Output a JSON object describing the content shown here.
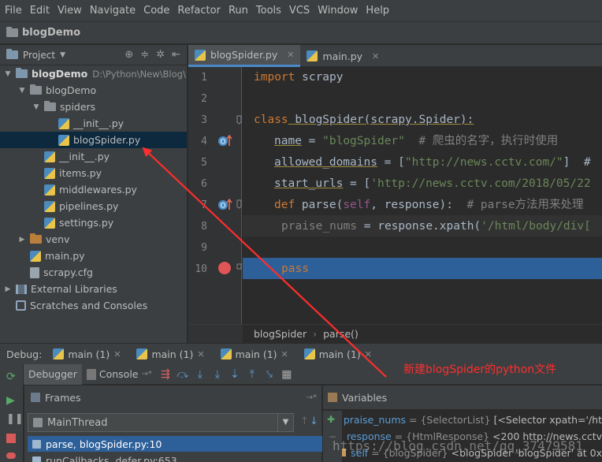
{
  "menu": [
    "File",
    "Edit",
    "View",
    "Navigate",
    "Code",
    "Refactor",
    "Run",
    "Tools",
    "VCS",
    "Window",
    "Help"
  ],
  "navbar": {
    "project": "blogDemo"
  },
  "project_panel": {
    "title": "Project",
    "tree": [
      {
        "label": "blogDemo",
        "path": "D:\\Python\\New\\Blog\\b",
        "icon": "folder-icon",
        "depth": 0,
        "expanded": true,
        "bold": true
      },
      {
        "label": "blogDemo",
        "icon": "folder-icon",
        "depth": 1,
        "expanded": true
      },
      {
        "label": "spiders",
        "icon": "folder-icon",
        "depth": 2,
        "expanded": true
      },
      {
        "label": "__init__.py",
        "icon": "python-file-icon",
        "depth": 3
      },
      {
        "label": "blogSpider.py",
        "icon": "python-file-icon",
        "depth": 3,
        "selected": true
      },
      {
        "label": "__init__.py",
        "icon": "python-file-icon",
        "depth": 2
      },
      {
        "label": "items.py",
        "icon": "python-file-icon",
        "depth": 2
      },
      {
        "label": "middlewares.py",
        "icon": "python-file-icon",
        "depth": 2
      },
      {
        "label": "pipelines.py",
        "icon": "python-file-icon",
        "depth": 2
      },
      {
        "label": "settings.py",
        "icon": "python-file-icon",
        "depth": 2
      },
      {
        "label": "venv",
        "icon": "folder-icon",
        "depth": 1,
        "expanded": false,
        "orange": true
      },
      {
        "label": "main.py",
        "icon": "python-file-icon",
        "depth": 1
      },
      {
        "label": "scrapy.cfg",
        "icon": "config-file-icon",
        "depth": 1
      },
      {
        "label": "External Libraries",
        "icon": "library-icon",
        "depth": 0,
        "expanded": false
      },
      {
        "label": "Scratches and Consoles",
        "icon": "scratches-icon",
        "depth": 0,
        "leaf": true
      }
    ]
  },
  "editor": {
    "tabs": [
      {
        "label": "blogSpider.py",
        "active": true
      },
      {
        "label": "main.py",
        "active": false
      }
    ],
    "line_numbers": [
      "1",
      "2",
      "3",
      "4",
      "5",
      "6",
      "7",
      "8",
      "9",
      "10"
    ],
    "code": {
      "l1_kw": "import",
      "l1_rest": " scrapy",
      "l3_kw": "class",
      "l3_rest": " blogSpider(scrapy.Spider):",
      "l4_name": "name",
      "l4_eq": " = ",
      "l4_str": "\"blogSpider\"",
      "l4_cmt": "  # 爬虫的名字，执行时使用",
      "l5_name": "allowed_domains",
      "l5_eq": " = [",
      "l5_str": "\"http://news.cctv.com/\"",
      "l5_end": "]  #",
      "l6_name": "start_urls",
      "l6_eq": " = [",
      "l6_str": "'http://news.cctv.com/2018/05/22",
      "l7_kw": "def",
      "l7_fn": " parse(",
      "l7_self": "self",
      "l7_rest": ", response):  ",
      "l7_cmt": "# parse方法用来处理",
      "l8_name": "praise_nums",
      "l8_eq": " = response.xpath(",
      "l8_str": "'/html/body/div[",
      "l10_kw": "pass"
    },
    "breadcrumb": [
      "blogSpider",
      "parse()"
    ]
  },
  "debug": {
    "title": "Debug:",
    "tabs": [
      "main (1)",
      "main (1)",
      "main (1)",
      "main (1)"
    ],
    "subtabs": {
      "debugger": "Debugger",
      "console": "Console"
    },
    "frames_title": "Frames",
    "variables_title": "Variables",
    "thread": "MainThread",
    "frames": [
      "parse, blogSpider.py:10",
      "runCallbacks, defer.py:653"
    ],
    "variables": [
      {
        "name": "praise_nums",
        "type": "= {SelectorList}",
        "value": "[<Selector xpath='/ht"
      },
      {
        "name": "response",
        "type": "= {HtmlResponse}",
        "value": "<200 http://news.cctv"
      },
      {
        "name": "self",
        "type": "= {blogSpider}",
        "value": "<blogSpider 'blogSpider' at 0x"
      }
    ]
  },
  "annotation": "新建blogSpider的python文件",
  "watermark": "https://blog.csdn.net/qq_37479581",
  "colors": {
    "accent": "#2d6099",
    "annotation": "#ff2d2d",
    "breakpoint": "#e05555"
  }
}
